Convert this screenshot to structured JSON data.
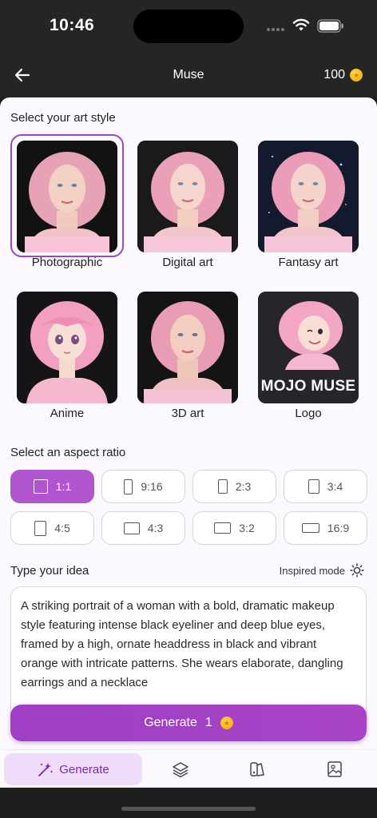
{
  "status": {
    "time": "10:46"
  },
  "header": {
    "title": "Muse",
    "credits": "100"
  },
  "styles": {
    "title": "Select your art style",
    "items": [
      {
        "label": "Photographic",
        "selected": true
      },
      {
        "label": "Digital art",
        "selected": false
      },
      {
        "label": "Fantasy art",
        "selected": false
      },
      {
        "label": "Anime",
        "selected": false
      },
      {
        "label": "3D art",
        "selected": false
      },
      {
        "label": "Logo",
        "selected": false
      }
    ],
    "logo_text": "MOJO MUSE"
  },
  "aspect": {
    "title": "Select an aspect ratio",
    "items": [
      {
        "label": "1:1",
        "active": true
      },
      {
        "label": "9:16",
        "active": false
      },
      {
        "label": "2:3",
        "active": false
      },
      {
        "label": "3:4",
        "active": false
      },
      {
        "label": "4:5",
        "active": false
      },
      {
        "label": "4:3",
        "active": false
      },
      {
        "label": "3:2",
        "active": false
      },
      {
        "label": "16:9",
        "active": false
      }
    ]
  },
  "idea": {
    "title": "Type your idea",
    "inspired_label": "Inspired mode",
    "text": "A striking portrait of a woman with a bold, dramatic makeup style featuring intense black eyeliner and deep blue eyes, framed by a high, ornate headdress in black and vibrant orange with intricate patterns. She wears elaborate, dangling earrings and a necklace"
  },
  "generate": {
    "label": "Generate",
    "cost": "1"
  },
  "tabs": [
    {
      "label": "Generate",
      "icon": "magic-wand-icon",
      "active": true
    },
    {
      "label": "",
      "icon": "layers-icon",
      "active": false
    },
    {
      "label": "",
      "icon": "styles-icon",
      "active": false
    },
    {
      "label": "",
      "icon": "gallery-icon",
      "active": false
    }
  ],
  "colors": {
    "accent": "#a944c6",
    "header": "#252525",
    "tab_active_bg": "#eedcf9"
  }
}
